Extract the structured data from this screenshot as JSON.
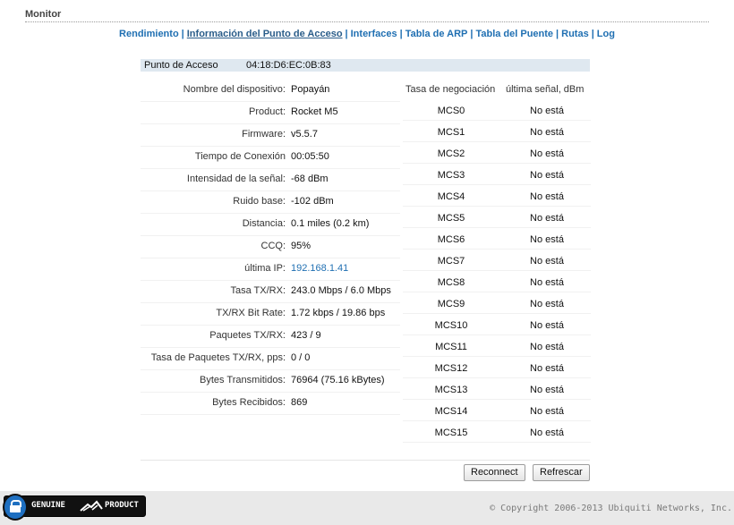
{
  "section": {
    "title": "Monitor"
  },
  "tabs": [
    {
      "label": "Rendimiento",
      "active": false
    },
    {
      "label": "Información del Punto de Acceso",
      "active": true
    },
    {
      "label": "Interfaces",
      "active": false
    },
    {
      "label": "Tabla de ARP",
      "active": false
    },
    {
      "label": "Tabla del Puente",
      "active": false
    },
    {
      "label": "Rutas",
      "active": false
    },
    {
      "label": "Log",
      "active": false
    }
  ],
  "access_point": {
    "label": "Punto de Acceso",
    "mac": "04:18:D6:EC:0B:83"
  },
  "info": [
    {
      "label": "Nombre del dispositivo:",
      "value": "Popayán"
    },
    {
      "label": "Product:",
      "value": "Rocket M5"
    },
    {
      "label": "Firmware:",
      "value": "v5.5.7"
    },
    {
      "label": "Tiempo de Conexión",
      "value": "00:05:50"
    },
    {
      "label": "Intensidad de la señal:",
      "value": "-68 dBm"
    },
    {
      "label": "Ruido base:",
      "value": "-102 dBm"
    },
    {
      "label": "Distancia:",
      "value": "0.1 miles (0.2 km)"
    },
    {
      "label": "CCQ:",
      "value": "95%"
    },
    {
      "label": "última IP:",
      "value": "192.168.1.41"
    },
    {
      "label": "Tasa TX/RX:",
      "value": "243.0 Mbps / 6.0 Mbps"
    },
    {
      "label": "TX/RX Bit Rate:",
      "value": "1.72 kbps / 19.86 bps"
    },
    {
      "label": "Paquetes TX/RX:",
      "value": "423 / 9"
    },
    {
      "label": "Tasa de Paquetes TX/RX, pps:",
      "value": "0 / 0"
    },
    {
      "label": "Bytes Transmitidos:",
      "value": "76964 (75.16 kBytes)"
    },
    {
      "label": "Bytes Recibidos:",
      "value": "869"
    }
  ],
  "rates": {
    "col_rate": "Tasa de negociación",
    "col_signal": "última señal, dBm",
    "rows": [
      {
        "rate": "MCS0",
        "status": "No está"
      },
      {
        "rate": "MCS1",
        "status": "No está"
      },
      {
        "rate": "MCS2",
        "status": "No está"
      },
      {
        "rate": "MCS3",
        "status": "No está"
      },
      {
        "rate": "MCS4",
        "status": "No está"
      },
      {
        "rate": "MCS5",
        "status": "No está"
      },
      {
        "rate": "MCS6",
        "status": "No está"
      },
      {
        "rate": "MCS7",
        "status": "No está"
      },
      {
        "rate": "MCS8",
        "status": "No está"
      },
      {
        "rate": "MCS9",
        "status": "No está"
      },
      {
        "rate": "MCS10",
        "status": "No está"
      },
      {
        "rate": "MCS11",
        "status": "No está"
      },
      {
        "rate": "MCS12",
        "status": "No está"
      },
      {
        "rate": "MCS13",
        "status": "No está"
      },
      {
        "rate": "MCS14",
        "status": "No está"
      },
      {
        "rate": "MCS15",
        "status": "No está"
      }
    ]
  },
  "buttons": {
    "reconnect": "Reconnect",
    "refresh": "Refrescar"
  },
  "footer": {
    "badge_left": "GENUINE",
    "badge_right": "PRODUCT",
    "copyright": "© Copyright 2006-2013 Ubiquiti Networks, Inc."
  },
  "colors": {
    "link": "#1f6fb2",
    "header_bg": "#dfe8f0",
    "badge_blue": "#1e6fc0"
  },
  "icons": {
    "badge_lock": "lock-icon",
    "badge_logo": "ubiquiti-logo-icon"
  }
}
